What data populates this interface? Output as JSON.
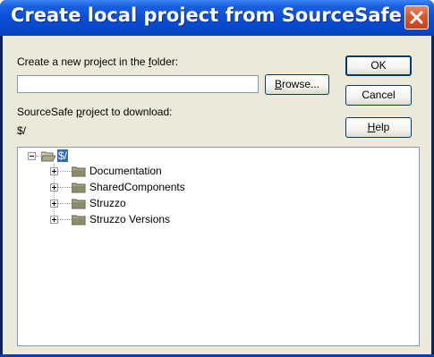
{
  "window": {
    "title": "Create local project from SourceSafe",
    "close_icon": "close-icon"
  },
  "form": {
    "folder_label_pre": "Create a new project in the ",
    "folder_label_accel": "f",
    "folder_label_post": "older:",
    "folder_value": "",
    "browse_pre": "",
    "browse_accel": "B",
    "browse_post": "rowse...",
    "project_label_pre": "SourceSafe ",
    "project_label_accel": "p",
    "project_label_post": "roject to download:",
    "project_path": "$/"
  },
  "buttons": {
    "ok": "OK",
    "cancel": "Cancel",
    "help_accel": "H",
    "help_post": "elp"
  },
  "tree": {
    "root": {
      "label": "$/",
      "expanded": true
    },
    "children": [
      {
        "label": "Documentation",
        "expanded": false
      },
      {
        "label": "SharedComponents",
        "expanded": false
      },
      {
        "label": "Struzzo",
        "expanded": false
      },
      {
        "label": "Struzzo Versions",
        "expanded": false
      }
    ]
  },
  "colors": {
    "titlebar": "#0a4ed6",
    "client": "#ece9d8",
    "selection": "#316ac5",
    "folder": "#8c8c6a"
  }
}
